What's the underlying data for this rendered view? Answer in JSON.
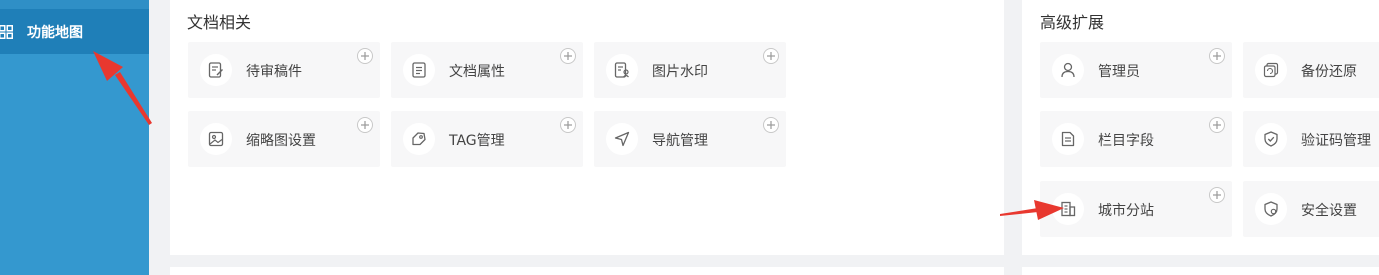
{
  "sidebar": {
    "items": [
      {
        "label": "功能地图",
        "icon": "grid-icon",
        "active": true
      }
    ]
  },
  "panels": {
    "docs": {
      "title": "文档相关",
      "cards": [
        {
          "label": "待审稿件",
          "icon": "edit-doc-icon"
        },
        {
          "label": "文档属性",
          "icon": "document-icon"
        },
        {
          "label": "图片水印",
          "icon": "image-watermark-icon"
        },
        {
          "label": "缩略图设置",
          "icon": "image-icon"
        },
        {
          "label": "TAG管理",
          "icon": "tag-icon"
        },
        {
          "label": "导航管理",
          "icon": "navigation-icon"
        }
      ]
    },
    "advanced": {
      "title": "高级扩展",
      "cards": [
        {
          "label": "管理员",
          "icon": "user-icon"
        },
        {
          "label": "备份还原",
          "icon": "backup-icon"
        },
        {
          "label": "栏目字段",
          "icon": "field-doc-icon"
        },
        {
          "label": "验证码管理",
          "icon": "shield-check-icon"
        },
        {
          "label": "城市分站",
          "icon": "building-icon"
        },
        {
          "label": "安全设置",
          "icon": "security-icon"
        }
      ]
    }
  },
  "colors": {
    "sidebar": "#3498cf",
    "sidebar_active": "#1f7fb8",
    "card_bg": "#f7f7f8",
    "annotation_arrow": "#e8382f"
  }
}
